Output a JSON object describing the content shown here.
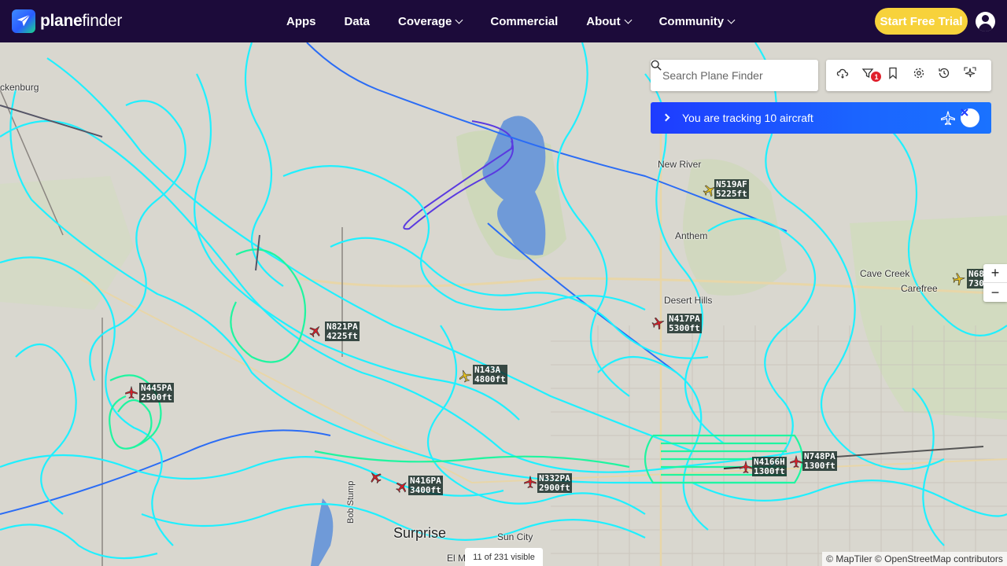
{
  "brand": {
    "name_bold": "plane",
    "name_light": "finder"
  },
  "nav": {
    "items": [
      {
        "label": "Apps",
        "dropdown": false
      },
      {
        "label": "Data",
        "dropdown": false
      },
      {
        "label": "Coverage",
        "dropdown": true
      },
      {
        "label": "Commercial",
        "dropdown": false
      },
      {
        "label": "About",
        "dropdown": true
      },
      {
        "label": "Community",
        "dropdown": true
      }
    ],
    "cta_label": "Start Free Trial",
    "account_icon": "user-circle-icon"
  },
  "search": {
    "placeholder": "Search Plane Finder",
    "icon": "search-icon"
  },
  "toolbar": {
    "icons": [
      "weather-cloud-icon",
      "filter-icon",
      "bookmark-icon",
      "gear-icon",
      "history-icon",
      "ar-view-icon"
    ],
    "filter_badge": "1"
  },
  "tracking": {
    "message": "You are tracking 10 aircraft"
  },
  "aircraft": [
    {
      "callsign": "N519AF",
      "altitude": "5225ft"
    },
    {
      "callsign": "N821PA",
      "altitude": "4225ft"
    },
    {
      "callsign": "N417PA",
      "altitude": "5300ft"
    },
    {
      "callsign": "N143A",
      "altitude": "4800ft"
    },
    {
      "callsign": "N445PA",
      "altitude": "2500ft"
    },
    {
      "callsign": "N416PA",
      "altitude": "3400ft"
    },
    {
      "callsign": "N332PA",
      "altitude": "2900ft"
    },
    {
      "callsign": "N4166H",
      "altitude": "1300ft"
    },
    {
      "callsign": "N748PA",
      "altitude": "1300ft"
    },
    {
      "callsign": "N68",
      "altitude": "730"
    }
  ],
  "places": [
    {
      "name": "ckenburg"
    },
    {
      "name": "New River"
    },
    {
      "name": "Anthem"
    },
    {
      "name": "Desert Hills"
    },
    {
      "name": "Cave Creek"
    },
    {
      "name": "Carefree"
    },
    {
      "name": "Surprise"
    },
    {
      "name": "Sun City"
    },
    {
      "name": "El M"
    },
    {
      "name": "Bob Stump"
    }
  ],
  "map_controls": {
    "zoom_in": "+",
    "zoom_out": "−"
  },
  "status": {
    "visible_count": "11 of 231 visible"
  },
  "attribution": "© MapTiler © OpenStreetMap contributors",
  "colors": {
    "nav_bg": "#1c0b3a",
    "cta": "#f7d23b",
    "track_cyan": "#1ff0ff",
    "track_green": "#1ff5a0",
    "tracking_bar": "#1e3cff",
    "water": "#6f9ad8"
  }
}
